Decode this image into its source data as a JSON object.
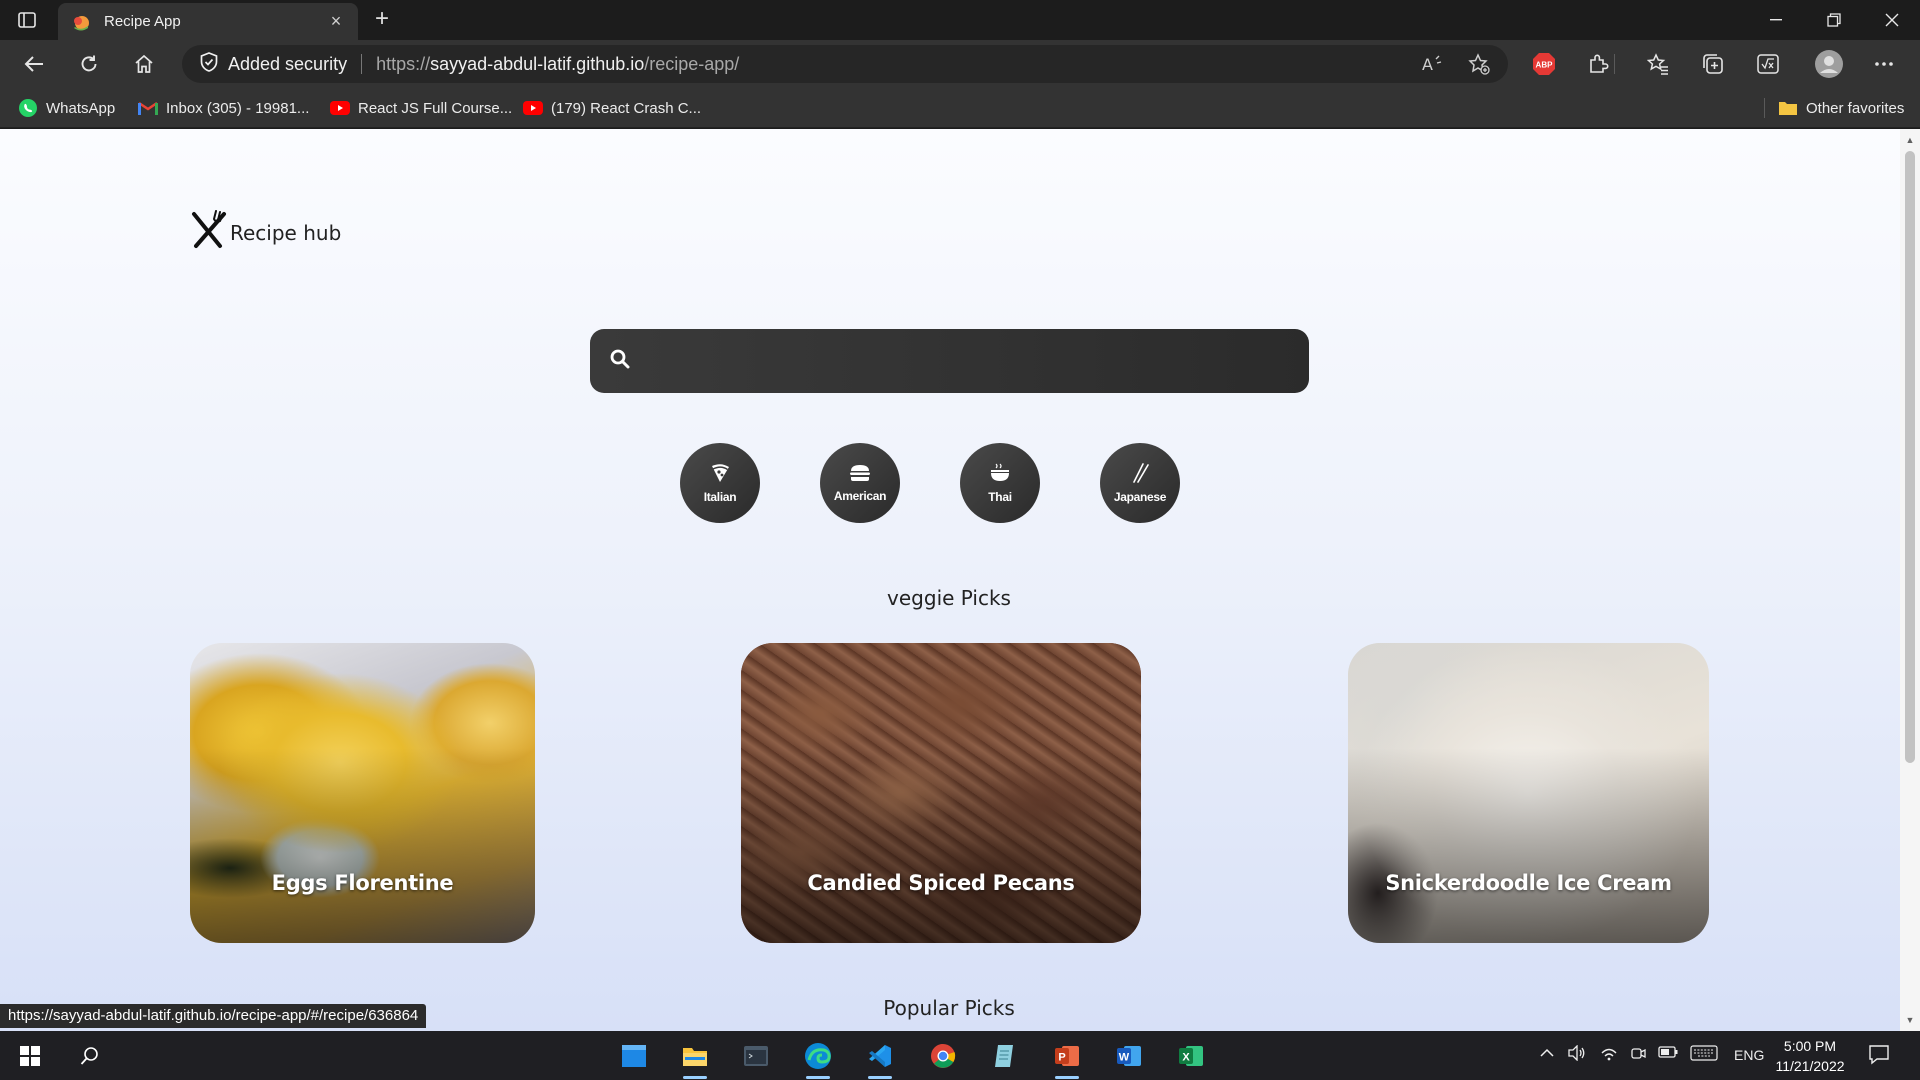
{
  "browser": {
    "tab_title": "Recipe App",
    "tab_close": "×",
    "new_tab": "+",
    "security_label": "Added security",
    "url_prefix": "https://",
    "url_host": "sayyad-abdul-latif.github.io",
    "url_path": "/recipe-app/",
    "abp_label": "ABP"
  },
  "bookmarks": {
    "items": [
      {
        "label": "WhatsApp",
        "icon": "whatsapp-icon"
      },
      {
        "label": "Inbox (305) - 19981...",
        "icon": "gmail-icon"
      },
      {
        "label": "React JS Full Course...",
        "icon": "youtube-icon"
      },
      {
        "label": "(179) React Crash C...",
        "icon": "youtube-icon"
      }
    ],
    "other_favorites": "Other favorites"
  },
  "app": {
    "logo_text": "Recipe hub",
    "search_placeholder": "",
    "cuisines": [
      {
        "label": "Italian",
        "icon": "pizza-icon"
      },
      {
        "label": "American",
        "icon": "burger-icon"
      },
      {
        "label": "Thai",
        "icon": "noodle-bowl-icon"
      },
      {
        "label": "Japanese",
        "icon": "chopsticks-icon"
      }
    ],
    "veggie_title": "veggie Picks",
    "veggie_cards": [
      {
        "title": "Eggs Florentine"
      },
      {
        "title": "Candied Spiced Pecans"
      },
      {
        "title": "Snickerdoodle Ice Cream"
      }
    ],
    "popular_title": "Popular Picks"
  },
  "status_bar": {
    "hover_url": "https://sayyad-abdul-latif.github.io/recipe-app/#/recipe/636864"
  },
  "taskbar": {
    "language": "ENG",
    "time": "5:00 PM",
    "date": "11/21/2022"
  },
  "colors": {
    "chrome_dark": "#1c1c1c",
    "chrome_mid": "#333333",
    "search_bg": "#2b2b2b",
    "page_bg_top": "#fbfcff",
    "page_bg_bottom": "#d7e0f7"
  }
}
